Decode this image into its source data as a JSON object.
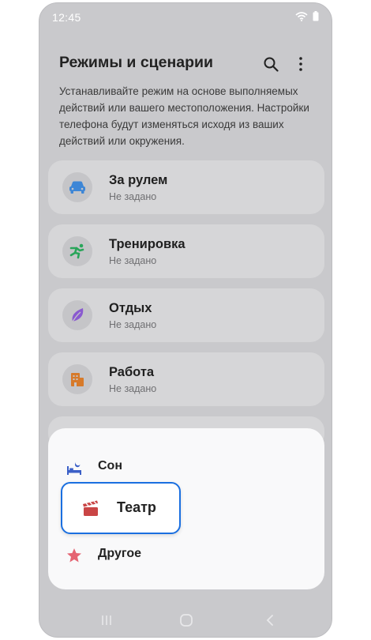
{
  "status": {
    "time": "12:45"
  },
  "header": {
    "title": "Режимы и сценарии"
  },
  "description": "Устанавливайте режим на основе выполняемых действий или вашего местоположения. Настройки телефона будут изменяться исходя из ваших действий или окружения.",
  "modes": [
    {
      "label": "За рулем",
      "status": "Не задано",
      "icon": "car-icon",
      "color": "#3d86d6"
    },
    {
      "label": "Тренировка",
      "status": "Не задано",
      "icon": "running-person-icon",
      "color": "#29a55a"
    },
    {
      "label": "Отдых",
      "status": "Не задано",
      "icon": "leaf-icon",
      "color": "#8a5ad0"
    },
    {
      "label": "Работа",
      "status": "Не задано",
      "icon": "office-building-icon",
      "color": "#d77a2a"
    }
  ],
  "sheet": {
    "options": [
      {
        "label": "Сон",
        "icon": "bed-moon-icon",
        "color": "#3b5fc7"
      },
      {
        "label": "Театр",
        "icon": "clapperboard-icon",
        "color": "#c94545",
        "highlighted": true
      },
      {
        "label": "Другое",
        "icon": "star-icon",
        "color": "#e56472"
      }
    ]
  },
  "colors": {
    "highlight_border": "#1a6fe0",
    "background": "#c9c9cc"
  }
}
